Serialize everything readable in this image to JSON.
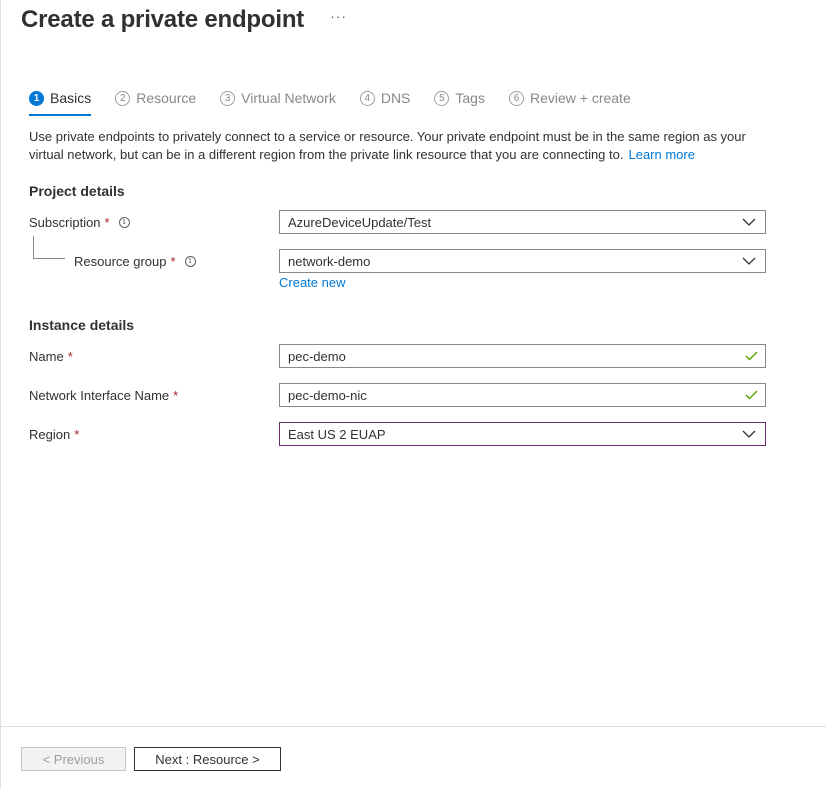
{
  "header": {
    "title": "Create a private endpoint",
    "more": "···"
  },
  "tabs": [
    {
      "num": "1",
      "label": "Basics"
    },
    {
      "num": "2",
      "label": "Resource"
    },
    {
      "num": "3",
      "label": "Virtual Network"
    },
    {
      "num": "4",
      "label": "DNS"
    },
    {
      "num": "5",
      "label": "Tags"
    },
    {
      "num": "6",
      "label": "Review + create"
    }
  ],
  "intro": {
    "text": "Use private endpoints to privately connect to a service or resource. Your private endpoint must be in the same region as your virtual network, but can be in a different region from the private link resource that you are connecting to.",
    "link": "Learn more"
  },
  "project": {
    "heading": "Project details",
    "subscription": {
      "label": "Subscription",
      "value": "AzureDeviceUpdate/Test"
    },
    "resource_group": {
      "label": "Resource group",
      "value": "network-demo"
    },
    "create_new": "Create new"
  },
  "instance": {
    "heading": "Instance details",
    "name": {
      "label": "Name",
      "value": "pec-demo"
    },
    "nic": {
      "label": "Network Interface Name",
      "value": "pec-demo-nic"
    },
    "region": {
      "label": "Region",
      "value": "East US 2 EUAP"
    }
  },
  "common": {
    "required": "*",
    "info": "i"
  },
  "footer": {
    "previous": "< Previous",
    "next": "Next : Resource >"
  },
  "colors": {
    "accent": "#0078d4",
    "required": "#a4262c",
    "valid": "#57a300",
    "focus_border": "#6b2c70"
  }
}
